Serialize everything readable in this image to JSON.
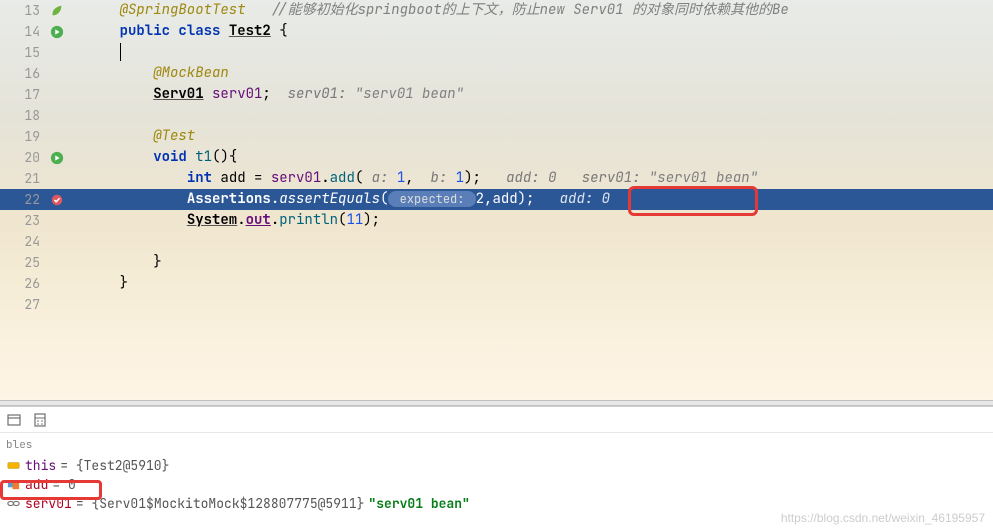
{
  "lines": {
    "l13": {
      "num": "13",
      "annotation": "@SpringBootTest",
      "comment": "//能够初始化springboot的上下文，防止new Serv01 的对象同时依赖其他的Be"
    },
    "l14": {
      "num": "14",
      "kw1": "public",
      "kw2": "class",
      "cls": "Test2",
      "brace": " {"
    },
    "l15": {
      "num": "15"
    },
    "l16": {
      "num": "16",
      "annotation": "@MockBean"
    },
    "l17": {
      "num": "17",
      "cls": "Serv01",
      "field": "serv01",
      "semi": ";",
      "inlay": "  serv01: ",
      "str": "\"serv01 bean\""
    },
    "l18": {
      "num": "18"
    },
    "l19": {
      "num": "19",
      "annotation": "@Test"
    },
    "l20": {
      "num": "20",
      "kw": "void",
      "method": "t1",
      "rest": "(){"
    },
    "l21": {
      "num": "21",
      "kw": "int",
      "var": " add = ",
      "field": "serv01",
      "dot": ".",
      "method": "add",
      "open": "(",
      "p1": " a: ",
      "n1": "1",
      "comma": ",  ",
      "p2": "b: ",
      "n2": "1",
      "close": ");",
      "inlay1": "   add: 0   serv01: ",
      "str": "\"serv01 bean\""
    },
    "l22": {
      "num": "22",
      "cls": "Assertions",
      "dot": ".",
      "method": "assertEquals",
      "open": "(",
      "pill": " expected: ",
      "n": "2",
      "rest": ",add);",
      "inlay": "   add: 0"
    },
    "l23": {
      "num": "23",
      "cls": "System",
      "dot1": ".",
      "field": "out",
      "dot2": ".",
      "method": "println",
      "open": "(",
      "n": "11",
      "close": ");"
    },
    "l24": {
      "num": "24"
    },
    "l25": {
      "num": "25",
      "brace": "}"
    },
    "l26": {
      "num": "26",
      "brace": "}"
    },
    "l27": {
      "num": "27"
    }
  },
  "debug": {
    "title": "bles",
    "vars": {
      "this_name": "this",
      "this_val": " = {Test2@5910}",
      "add_name": "add",
      "add_val": " = 0",
      "serv_name": "serv01",
      "serv_val": " = {Serv01$MockitoMock$128807775@5911} ",
      "serv_str": "\"serv01 bean\""
    }
  },
  "watermark": "https://blog.csdn.net/weixin_46195957"
}
